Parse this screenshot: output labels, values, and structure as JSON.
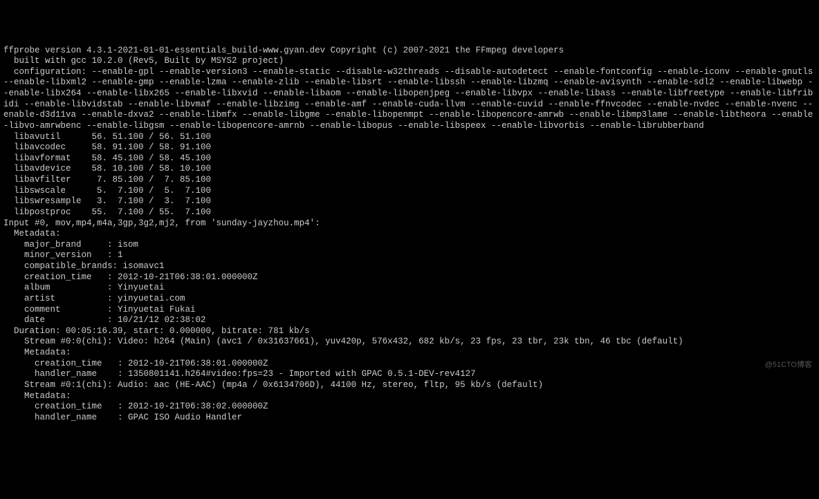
{
  "terminal": {
    "lines": [
      "ffprobe version 4.3.1-2021-01-01-essentials_build-www.gyan.dev Copyright (c) 2007-2021 the FFmpeg developers",
      "  built with gcc 10.2.0 (Rev5, Built by MSYS2 project)",
      "  configuration: --enable-gpl --enable-version3 --enable-static --disable-w32threads --disable-autodetect --enable-fontconfig --enable-iconv --enable-gnutls --enable-libxml2 --enable-gmp --enable-lzma --enable-zlib --enable-libsrt --enable-libssh --enable-libzmq --enable-avisynth --enable-sdl2 --enable-libwebp --enable-libx264 --enable-libx265 --enable-libxvid --enable-libaom --enable-libopenjpeg --enable-libvpx --enable-libass --enable-libfreetype --enable-libfribidi --enable-libvidstab --enable-libvmaf --enable-libzimg --enable-amf --enable-cuda-llvm --enable-cuvid --enable-ffnvcodec --enable-nvdec --enable-nvenc --enable-d3d11va --enable-dxva2 --enable-libmfx --enable-libgme --enable-libopenmpt --enable-libopencore-amrwb --enable-libmp3lame --enable-libtheora --enable-libvo-amrwbenc --enable-libgsm --enable-libopencore-amrnb --enable-libopus --enable-libspeex --enable-libvorbis --enable-librubberband",
      "  libavutil      56. 51.100 / 56. 51.100",
      "  libavcodec     58. 91.100 / 58. 91.100",
      "  libavformat    58. 45.100 / 58. 45.100",
      "  libavdevice    58. 10.100 / 58. 10.100",
      "  libavfilter     7. 85.100 /  7. 85.100",
      "  libswscale      5.  7.100 /  5.  7.100",
      "  libswresample   3.  7.100 /  3.  7.100",
      "  libpostproc    55.  7.100 / 55.  7.100",
      "Input #0, mov,mp4,m4a,3gp,3g2,mj2, from 'sunday-jayzhou.mp4':",
      "  Metadata:",
      "    major_brand     : isom",
      "    minor_version   : 1",
      "    compatible_brands: isomavc1",
      "    creation_time   : 2012-10-21T06:38:01.000000Z",
      "    album           : Yinyuetai",
      "    artist          : yinyuetai.com",
      "    comment         : Yinyuetai Fukai",
      "    date            : 10/21/12 02:38:02",
      "  Duration: 00:05:16.39, start: 0.000000, bitrate: 781 kb/s",
      "    Stream #0:0(chi): Video: h264 (Main) (avc1 / 0x31637661), yuv420p, 576x432, 682 kb/s, 23 fps, 23 tbr, 23k tbn, 46 tbc (default)",
      "    Metadata:",
      "      creation_time   : 2012-10-21T06:38:01.000000Z",
      "      handler_name    : 1350801141.h264#video:fps=23 - Imported with GPAC 0.5.1-DEV-rev4127",
      "    Stream #0:1(chi): Audio: aac (HE-AAC) (mp4a / 0x6134706D), 44100 Hz, stereo, fltp, 95 kb/s (default)",
      "    Metadata:",
      "      creation_time   : 2012-10-21T06:38:02.000000Z",
      "      handler_name    : GPAC ISO Audio Handler"
    ]
  },
  "watermark": "@51CTO博客"
}
